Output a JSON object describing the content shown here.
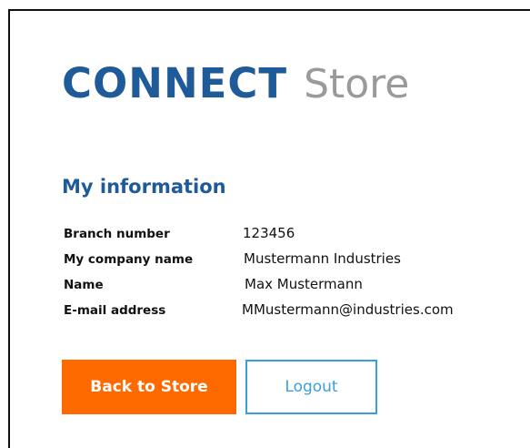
{
  "brand": {
    "connect": "CONNECT",
    "store": "Store",
    "colors": {
      "blue": "#1f5a99",
      "gray": "#9a9a9a"
    }
  },
  "section": {
    "title": "My information"
  },
  "info": [
    {
      "label": "Branch number",
      "value": "123456"
    },
    {
      "label": "My company name",
      "value": "Mustermann Industries"
    },
    {
      "label": "Name",
      "value": "Max Mustermann"
    },
    {
      "label": "E-mail address",
      "value": "MMustermann@industries.com"
    }
  ],
  "buttons": {
    "back_label": "Back to Store",
    "logout_label": "Logout"
  },
  "colors": {
    "accent": "#ff6a00",
    "button_border": "#3aa0d8",
    "brand_blue": "#1f5a99"
  }
}
